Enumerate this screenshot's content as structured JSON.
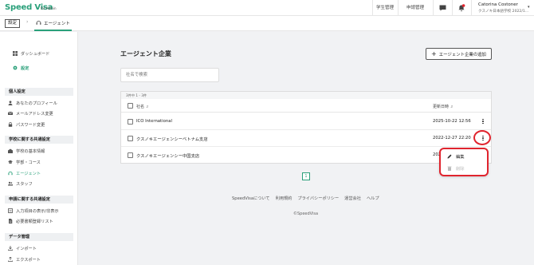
{
  "header": {
    "logo": "Speed Visa",
    "logo_sub": "for Admin",
    "nav": [
      "学生管理",
      "申請管理"
    ],
    "user_name": "Catorina Costoner",
    "user_org": "クスノキ日本語学校 2022/1..."
  },
  "breadcrumb": {
    "settings": "設定",
    "current": "エージェント"
  },
  "sidebar": {
    "top_items": [
      {
        "label": "ダッシュボード",
        "icon": "dashboard-icon"
      },
      {
        "label": "設定",
        "icon": "gear-icon"
      }
    ],
    "sections": [
      {
        "title": "個人設定",
        "items": [
          "あなたのプロフィール",
          "メールアドレス変更",
          "パスワード変更"
        ]
      },
      {
        "title": "学校に関する共通設定",
        "items": [
          "学校の基本情報",
          "学部・コース",
          "エージェント",
          "スタッフ"
        ]
      },
      {
        "title": "申請に関する共通設定",
        "items": [
          "入力項目の表示/非表示",
          "必要書類登録リスト"
        ]
      },
      {
        "title": "データ管理",
        "items": [
          "インポート",
          "エクスポート"
        ]
      }
    ]
  },
  "main": {
    "title": "エージェント企業",
    "add_button": "エージェント企業の追加",
    "search_placeholder": "社名で検索",
    "count_text": "3件中 1 - 3件",
    "columns": {
      "name": "社名",
      "updated": "更新日時"
    },
    "rows": [
      {
        "name": "ICO International",
        "date": "2025-10-22 12:56"
      },
      {
        "name": "クスノキエージェンシーベトナム支店",
        "date": "2022-12-27 22:20"
      },
      {
        "name": "クスノキエージェンシー中国支店",
        "date": "202"
      }
    ],
    "menu": {
      "edit": "編集",
      "delete": "削除"
    },
    "page": "1"
  },
  "footer": {
    "links": [
      "SpeedVisaについて",
      "利用規約",
      "プライバシーポリシー",
      "運営会社",
      "ヘルプ"
    ],
    "copyright": "©SpeedVisa"
  },
  "colors": {
    "brand": "#2aa07a",
    "highlight": "#e0242e"
  }
}
